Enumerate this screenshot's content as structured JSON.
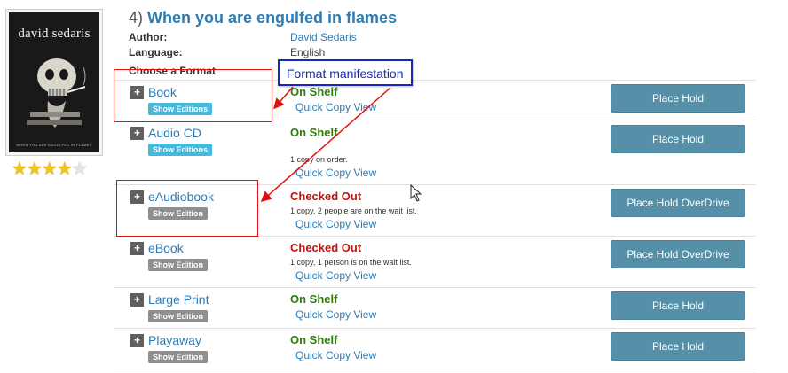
{
  "record": {
    "number": "4)",
    "title": "When you are engulfed in flames",
    "author_label": "Author:",
    "author": "David Sedaris",
    "language_label": "Language:",
    "language": "English",
    "cover_author_text": "david sedaris",
    "cover_subtitle": "WHEN YOU ARE ENGULFED IN FLAMES",
    "rating": {
      "value": 4,
      "max": 5
    }
  },
  "format_header": "Choose a Format",
  "annotation": {
    "label": "Format manifestation"
  },
  "formats": [
    {
      "name": "Book",
      "edition_btn": "Show Editions",
      "status": "On Shelf",
      "note": "",
      "quick_copy": "Quick Copy View",
      "action": "Place Hold"
    },
    {
      "name": "Audio CD",
      "edition_btn": "Show Editions",
      "status": "On Shelf",
      "note": "1 copy on order.",
      "quick_copy": "Quick Copy View",
      "action": "Place Hold"
    },
    {
      "name": "eAudiobook",
      "edition_btn": "Show Edition",
      "status": "Checked Out",
      "note": "1 copy, 2 people are on the wait list.",
      "quick_copy": "Quick Copy View",
      "action": "Place Hold OverDrive"
    },
    {
      "name": "eBook",
      "edition_btn": "Show Edition",
      "status": "Checked Out",
      "note": "1 copy, 1 person is on the wait list.",
      "quick_copy": "Quick Copy View",
      "action": "Place Hold OverDrive"
    },
    {
      "name": "Large Print",
      "edition_btn": "Show Edition",
      "status": "On Shelf",
      "note": "",
      "quick_copy": "Quick Copy View",
      "action": "Place Hold"
    },
    {
      "name": "Playaway",
      "edition_btn": "Show Edition",
      "status": "On Shelf",
      "note": "",
      "quick_copy": "Quick Copy View",
      "action": "Place Hold"
    }
  ],
  "colors": {
    "link": "#2e7cb4",
    "on_shelf": "#2f7d0a",
    "checked_out": "#c0140a",
    "hold_button": "#5590a8",
    "annotation_red": "#e01010",
    "annotation_blue": "#1a27b8"
  },
  "icons": {
    "expand": "plus-icon",
    "cursor": "mouse-pointer-icon",
    "stars": "star-icon"
  }
}
